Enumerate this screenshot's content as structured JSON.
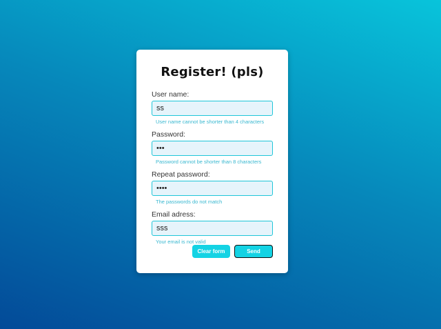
{
  "form": {
    "title": "Register! (pls)",
    "fields": [
      {
        "label": "User name:",
        "value": "ss",
        "error": "User name cannot be shorter than 4 characters"
      },
      {
        "label": "Password:",
        "value": "•••",
        "error": "Password cannot be shorter than 8 characters"
      },
      {
        "label": "Repeat password:",
        "value": "••••",
        "error": "The passwords do not match"
      },
      {
        "label": "Email adress:",
        "value": "sss",
        "error": "Your email is not valid"
      }
    ],
    "clear_label": "Clear form",
    "send_label": "Send"
  },
  "colors": {
    "accent": "#14d3e4",
    "error_text": "#3ab8d0",
    "input_bg": "#e6f4fb"
  }
}
